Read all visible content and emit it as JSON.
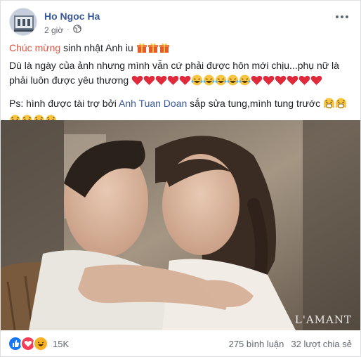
{
  "author": {
    "name": "Ho Ngoc Ha",
    "time": "2 giờ",
    "avatar_label": ""
  },
  "post": {
    "line1_highlight": "Chúc mừng",
    "line1_rest": " sinh nhật Anh iu ",
    "line2": "Dù là ngày của ảnh nhưng mình vẫn cứ phải được hôn mới chịu...phụ nữ là",
    "line3": "phải luôn được yêu thương ",
    "ps_prefix": "Ps: hình được tài trợ bởi ",
    "ps_link": "Anh Tuan Doan",
    "ps_suffix": " sắp sửa tung,mình tung trước "
  },
  "photo": {
    "watermark": "L'AMANT"
  },
  "stats": {
    "reactions_count": "15K",
    "comments": "275 bình luận",
    "shares": "32 lượt chia sẻ"
  },
  "icons": [
    "gift-icon",
    "heart-icon",
    "laughing-icon",
    "shocked-face-icon",
    "globe-icon",
    "more-icon",
    "like-reaction-icon",
    "love-reaction-icon",
    "haha-reaction-icon"
  ],
  "colors": {
    "name_link": "#385898",
    "highlight": "#e0513f",
    "meta": "#606770",
    "like_blue": "#1877f2",
    "love_red": "#f33e58",
    "haha_yellow": "#f7b125"
  }
}
